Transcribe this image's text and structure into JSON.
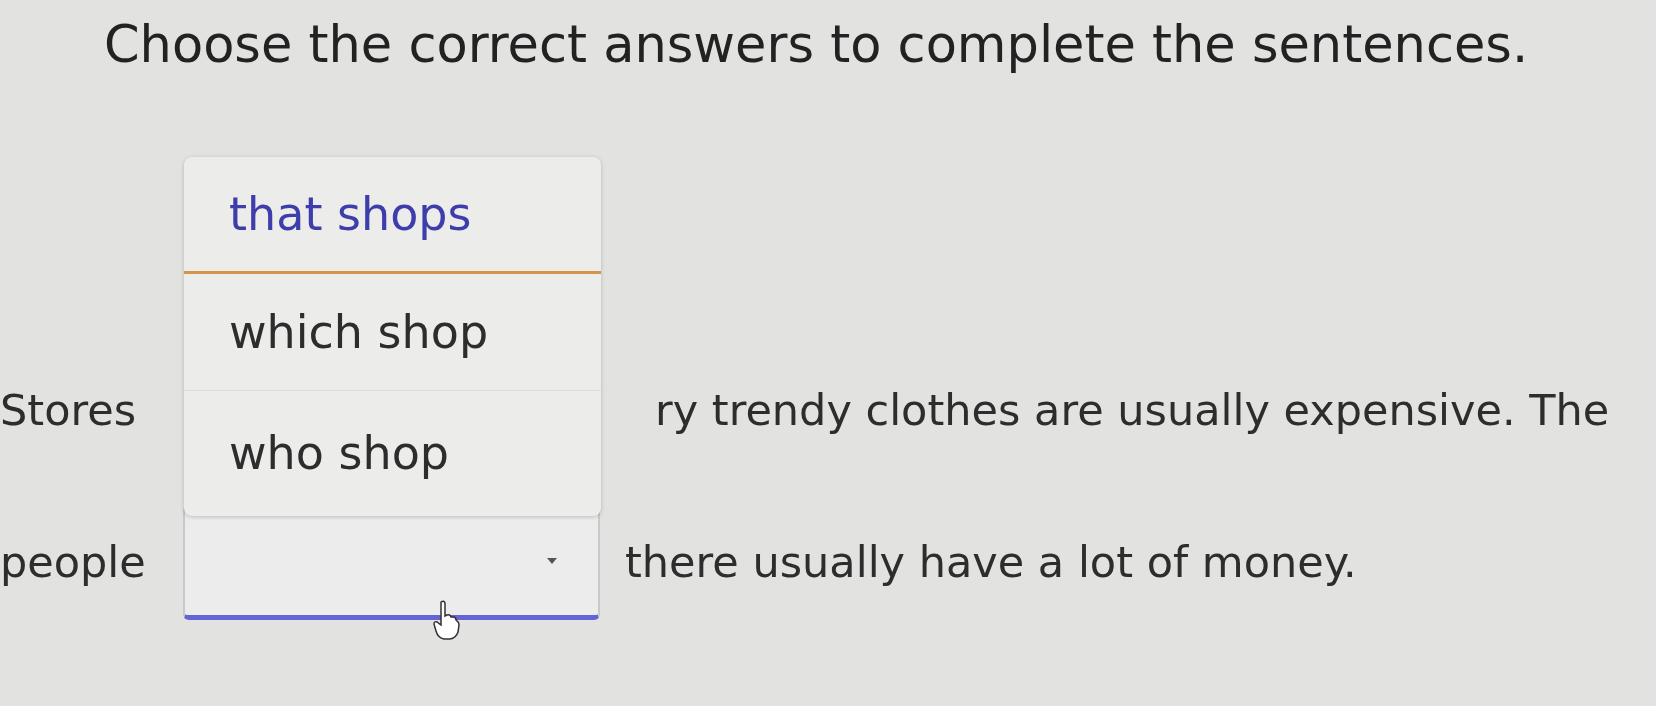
{
  "title": "Choose the correct answers to complete the sentences.",
  "sentences": [
    {
      "kind": "covered",
      "before": "Stores",
      "after": "ry trendy clothes are usually expensive. The"
    },
    {
      "kind": "dropdown",
      "before": "people",
      "after": "there usually have a lot of money."
    }
  ],
  "menu": {
    "options": [
      {
        "label": "that shops",
        "selected": true
      },
      {
        "label": "which shop",
        "selected": false
      },
      {
        "label": "who shop",
        "selected": false
      }
    ]
  }
}
